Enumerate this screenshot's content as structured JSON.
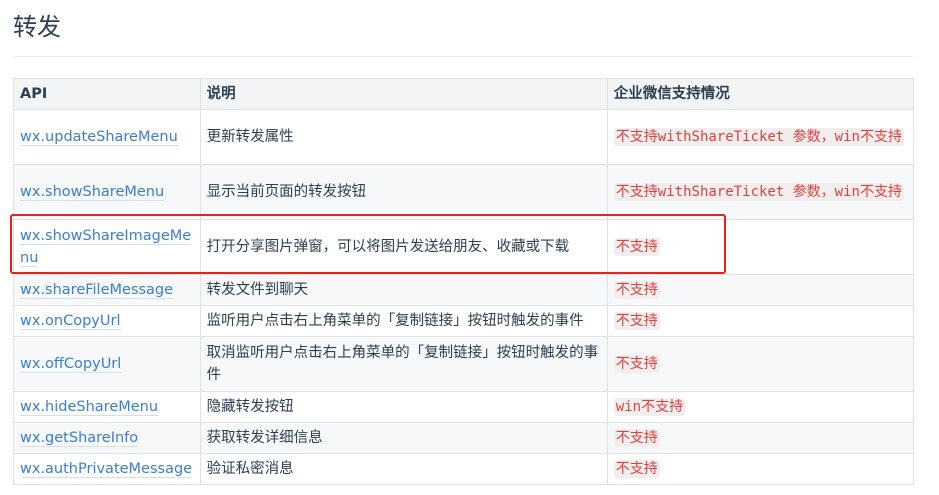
{
  "page": {
    "title": "转发"
  },
  "table": {
    "headers": {
      "api": "API",
      "desc": "说明",
      "support": "企业微信支持情况"
    },
    "rows": [
      {
        "api": "wx.updateShareMenu",
        "desc": "更新转发属性",
        "support": "不支持withShareTicket 参数，win不支持"
      },
      {
        "api": "wx.showShareMenu",
        "desc": "显示当前页面的转发按钮",
        "support": "不支持withShareTicket 参数，win不支持"
      },
      {
        "api": "wx.showShareImageMenu",
        "desc": "打开分享图片弹窗，可以将图片发送给朋友、收藏或下载",
        "support": "不支持"
      },
      {
        "api": "wx.shareFileMessage",
        "desc": "转发文件到聊天",
        "support": "不支持"
      },
      {
        "api": "wx.onCopyUrl",
        "desc": "监听用户点击右上角菜单的「复制链接」按钮时触发的事件",
        "support": "不支持"
      },
      {
        "api": "wx.offCopyUrl",
        "desc": "取消监听用户点击右上角菜单的「复制链接」按钮时触发的事件",
        "support": "不支持"
      },
      {
        "api": "wx.hideShareMenu",
        "desc": "隐藏转发按钮",
        "support": "win不支持"
      },
      {
        "api": "wx.getShareInfo",
        "desc": "获取转发详细信息",
        "support": "不支持"
      },
      {
        "api": "wx.authPrivateMessage",
        "desc": "验证私密消息",
        "support": "不支持"
      }
    ]
  },
  "colors": {
    "link": "#3b7ed0",
    "support_text": "#e2403c",
    "highlight_border": "#e8211f"
  }
}
